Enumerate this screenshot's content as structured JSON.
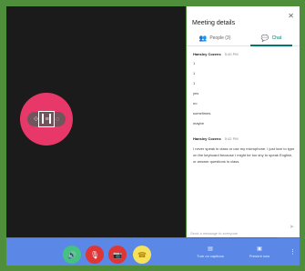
{
  "panel": {
    "title": "Meeting details",
    "close_icon": "✕",
    "tabs": [
      {
        "label": "People (3)",
        "icon": "people-icon",
        "glyph": "👥"
      },
      {
        "label": "Chat",
        "icon": "chat-icon",
        "glyph": "💬"
      }
    ]
  },
  "chat": {
    "messages": [
      {
        "sender": "Hansley Cozens",
        "time": "5:40 PM",
        "lines": [
          "1",
          "1",
          "1",
          "yes",
          "no",
          "sometimes",
          "maybe"
        ]
      },
      {
        "sender": "Hansley Cozens",
        "time": "5:42 PM",
        "text": "I never speak in class or use my microphone. I just love to type on the keyboard because I might be too shy to speak English, or answer questions in class."
      }
    ],
    "input_placeholder": "Send a message to everyone",
    "send_glyph": "➤"
  },
  "tile": {
    "controls": [
      "⟐",
      "≡",
      "◌"
    ]
  },
  "controls": {
    "audio_glyph": "🔊",
    "mic_glyph": "🎙",
    "camera_glyph": "📷",
    "leave_glyph": "☎",
    "captions_label": "Turn on captions",
    "captions_glyph": "▤",
    "present_label": "Present now",
    "present_glyph": "▣",
    "more_glyph": "⋮"
  },
  "colors": {
    "frame": "#4f8e3a",
    "bar": "#5b88e6",
    "accent": "#00796b",
    "tile": "#e8386a"
  }
}
